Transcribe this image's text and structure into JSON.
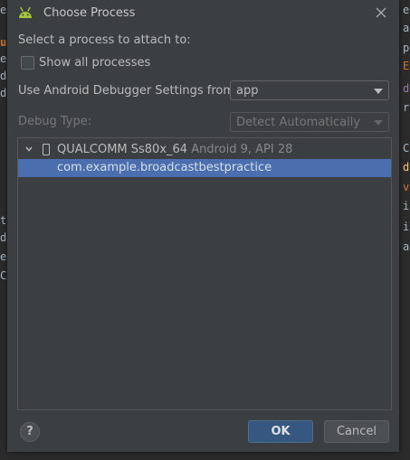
{
  "dialog": {
    "title": "Choose Process",
    "prompt": "Select a process to attach to:",
    "show_all_label": "Show all processes",
    "show_all_checked": false,
    "debugger_settings_label": "Use Android Debugger Settings from:",
    "debugger_settings_value": "app",
    "debug_type_label": "Debug Type:",
    "debug_type_value": "Detect Automatically",
    "device": {
      "name": "QUALCOMM Ss80x_64",
      "info": "Android 9, API 28"
    },
    "process": "com.example.broadcastbestpractice",
    "help_label": "?",
    "ok_label": "OK",
    "cancel_label": "Cancel"
  },
  "background": {
    "left_fragments": [
      "e",
      "ur",
      "e",
      "d",
      "d-",
      "ti",
      "dl",
      "es",
      "Co"
    ],
    "right_fragments": [
      "e",
      "a",
      "p",
      "E",
      "d",
      "r",
      "C",
      "d",
      "v",
      "i",
      "i",
      "a"
    ]
  },
  "colors": {
    "dialog_bg": "#3c3f41",
    "selection": "#4b6eaf",
    "ok_button": "#365880",
    "android_green": "#a4c639"
  }
}
